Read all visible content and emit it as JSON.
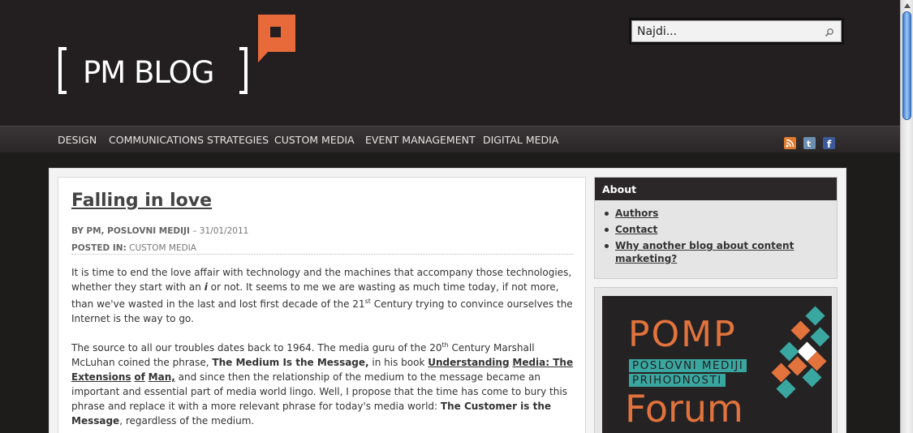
{
  "header": {
    "logo_text": "PM BLOG",
    "search_placeholder": "Najdi..."
  },
  "nav": {
    "items": [
      "DESIGN",
      "COMMUNICATIONS STRATEGIES",
      "CUSTOM MEDIA",
      "EVENT MANAGEMENT",
      "DIGITAL MEDIA"
    ],
    "social_icons": [
      "rss-icon",
      "twitter-icon",
      "facebook-icon"
    ]
  },
  "post": {
    "title": "Falling in love",
    "by_label": "BY",
    "author": "PM, POSLOVNI MEDIJI",
    "date_sep": "–",
    "date": "31/01/2011",
    "posted_in_label": "POSTED IN:",
    "category": "CUSTOM MEDIA",
    "p1": {
      "a": "It is time to end the love affair with technology and the machines that accompany those technologies, whether they start with an",
      "i": "i",
      "b": "or not.  It seems to me we are wasting as much time today, if not more, than we've wasted in the last and lost first decade of the 21",
      "sup": "st",
      "c": "Century trying to convince ourselves the Internet is the way to go."
    },
    "p2": {
      "a": "The source to all our troubles dates back to 1964.  The media guru of the 20",
      "sup": "th",
      "b": "Century Marshall McLuhan coined the phrase,",
      "bold1": "The Medium Is the Message,",
      "c": "in his book",
      "link1": "Understanding",
      "link2": "Media: The",
      "link3": "Extensions",
      "link4": "of",
      "link5": "Man,",
      "d": "and since then the relationship of the medium to the message became an important and essential part of media world lingo. Well, I propose that the time has come to bury this phrase and replace it with a more relevant phrase for today's media world:",
      "bold2": "The Customer is the Message",
      "e": ", regardless of the medium."
    }
  },
  "sidebar": {
    "about_title": "About",
    "about_links": [
      "Authors",
      "Contact",
      "Why another blog about content marketing?"
    ],
    "ad": {
      "line1": "POMP",
      "band1": "POSLOVNI MEDIJI",
      "band2": "PRIHODNOSTI",
      "line2": "Forum"
    }
  },
  "colors": {
    "accent": "#e86a3a",
    "teal": "#3aa6a0",
    "header_bg": "#231f20"
  }
}
